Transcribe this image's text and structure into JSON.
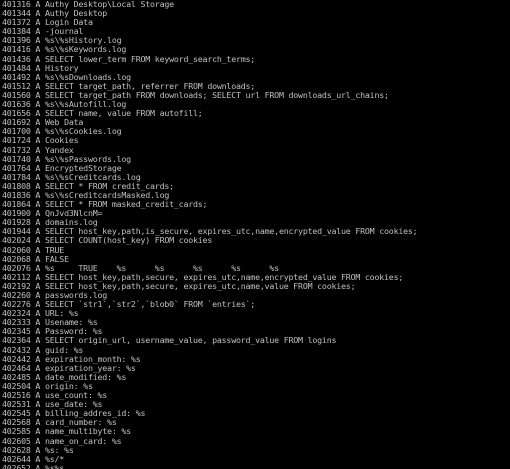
{
  "colors": {
    "background": "#000000",
    "text": "#c0c0c0"
  },
  "lines": [
    "401316 A Authy Desktop\\Local Storage",
    "401344 A Authy Desktop",
    "401372 A Login Data",
    "401384 A -journal",
    "401396 A %s\\%sHistory.log",
    "401416 A %s\\%sKeywords.log",
    "401436 A SELECT lower_term FROM keyword_search_terms;",
    "401484 A History",
    "401492 A %s\\%sDownloads.log",
    "401512 A SELECT target_path, referrer FROM downloads;",
    "401560 A SELECT target_path FROM downloads; SELECT url FROM downloads_url_chains;",
    "401636 A %s\\%sAutofill.log",
    "401656 A SELECT name, value FROM autofill;",
    "401692 A Web Data",
    "401700 A %s\\%sCookies.log",
    "401724 A Cookies",
    "401732 A Yandex",
    "401740 A %s\\%sPasswords.log",
    "401764 A EncryptedStorage",
    "401784 A %s\\%sCreditcards.log",
    "401808 A SELECT * FROM credit_cards;",
    "401836 A %s\\%sCreditcardsMasked.log",
    "401864 A SELECT * FROM masked_credit_cards;",
    "401900 A QnJvd3NlcnM=",
    "401928 A domains.log",
    "401944 A SELECT host_key,path,is_secure, expires_utc,name,encrypted_value FROM cookies;",
    "402024 A SELECT COUNT(host_key) FROM cookies",
    "402060 A TRUE",
    "402068 A FALSE",
    "402076 A %s     TRUE    %s      %s      %s      %s      %s",
    "402112 A SELECT host_key,path,secure, expires_utc,name,encrypted_value FROM cookies;",
    "402192 A SELECT host_key,path,secure, expires_utc,name,value FROM cookies;",
    "402260 A passwords.log",
    "402276 A SELECT `str1`,`str2`,`blob0` FROM `entries`;",
    "402324 A URL: %s",
    "402333 A Usename: %s",
    "402345 A Password: %s",
    "402364 A SELECT origin_url, username_value, password_value FROM logins",
    "402432 A guid: %s",
    "402442 A expiration_month: %s",
    "402464 A expiration_year: %s",
    "402485 A date_modified: %s",
    "402504 A origin: %s",
    "402516 A use_count: %s",
    "402531 A use_date: %s",
    "402545 A billing_addres_id: %s",
    "402568 A card_number: %s",
    "402585 A name_multibyte: %s",
    "402605 A name_on_card: %s",
    "402628 A %s: %s",
    "402644 A %s/*",
    "402652 A %s%s"
  ]
}
